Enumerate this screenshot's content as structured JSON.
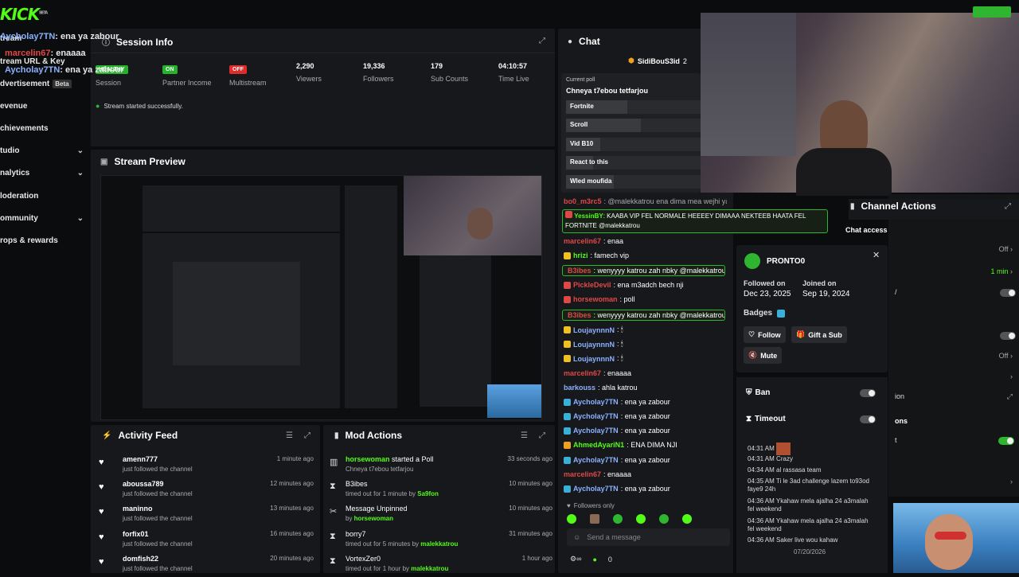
{
  "brand": {
    "logo": "KICK",
    "beta": "BETA"
  },
  "overlay": [
    {
      "name": "Aycholay7TN",
      "text": ": ena ya zabour",
      "color": "blue"
    },
    {
      "name": "marcelin67",
      "text": ": enaaaa",
      "color": "red"
    },
    {
      "name": "Aycholay7TN",
      "text": ": ena ya zabour",
      "color": "blue"
    }
  ],
  "sidebar": {
    "items": [
      {
        "label": "tream"
      },
      {
        "label": "tream URL & Key"
      },
      {
        "label": "dvertisement",
        "badge": "Beta"
      },
      {
        "label": "evenue"
      },
      {
        "label": "chievements"
      },
      {
        "label": "tudio",
        "chevron": true
      },
      {
        "label": "nalytics",
        "chevron": true
      },
      {
        "label": "loderation"
      },
      {
        "label": "ommunity",
        "chevron": true
      },
      {
        "label": "rops & rewards"
      }
    ]
  },
  "session": {
    "title": "Session Info",
    "stats": [
      {
        "value": "HEALTHY",
        "label": "Session",
        "kind": "badge-on"
      },
      {
        "value": "ON",
        "label": "Partner Income",
        "kind": "badge-on"
      },
      {
        "value": "OFF",
        "label": "Multistream",
        "kind": "badge-off"
      },
      {
        "value": "2,290",
        "label": "Viewers"
      },
      {
        "value": "19,336",
        "label": "Followers"
      },
      {
        "value": "179",
        "label": "Sub Counts"
      },
      {
        "value": "04:10:57",
        "label": "Time Live"
      }
    ],
    "status": "Stream started successfully."
  },
  "preview": {
    "title": "Stream Preview"
  },
  "activity": {
    "title": "Activity Feed",
    "rows": [
      {
        "name": "amenn777",
        "sub": "just followed the channel",
        "time": "1 minute ago"
      },
      {
        "name": "aboussa789",
        "sub": "just followed the channel",
        "time": "12 minutes ago"
      },
      {
        "name": "maninno",
        "sub": "just followed the channel",
        "time": "13 minutes ago"
      },
      {
        "name": "forfix01",
        "sub": "just followed the channel",
        "time": "16 minutes ago"
      },
      {
        "name": "domfish22",
        "sub": "just followed the channel",
        "time": "20 minutes ago"
      }
    ]
  },
  "mod": {
    "title": "Mod Actions",
    "rows": [
      {
        "icon": "poll-icon",
        "actor": "horsewoman",
        "action": " started a Poll",
        "sub": "Chneya t7ebou tetfarjou",
        "by": "",
        "time": "33 seconds ago"
      },
      {
        "icon": "hourglass-icon",
        "actor": "",
        "action": "B3ibes",
        "sub": "timed out for 1 minute by ",
        "by": "Sa9fon",
        "time": "10 minutes ago"
      },
      {
        "icon": "unpin-icon",
        "actor": "",
        "action": "Message Unpinned",
        "sub": "by ",
        "by": "horsewoman",
        "time": "10 minutes ago"
      },
      {
        "icon": "hourglass-icon",
        "actor": "",
        "action": "borry7",
        "sub": "timed out for 5 minutes by ",
        "by": "malekkatrou",
        "time": "31 minutes ago"
      },
      {
        "icon": "hourglass-icon",
        "actor": "",
        "action": "VortexZer0",
        "sub": "timed out for 1 hour by ",
        "by": "malekkatrou",
        "time": "1 hour ago"
      }
    ]
  },
  "chat": {
    "title": "Chat",
    "pinned_user": "SidiBouS3id",
    "pinned_count": "2",
    "poll": {
      "label": "Current poll",
      "question": "Chneya t7ebou tetfarjou",
      "options": [
        {
          "label": "Fortnite",
          "fill": 0.45
        },
        {
          "label": "Scroll",
          "fill": 0.55
        },
        {
          "label": "Vid B10",
          "fill": 0.25
        },
        {
          "label": "React to this",
          "fill": 0.2
        },
        {
          "label": "Wled moufida",
          "fill": 0.35
        }
      ]
    },
    "messages": [
      {
        "user": "bo0_m3rc5",
        "text": ": @malekkatrou ena dima mea wejhi ya pro",
        "color": "#e04848",
        "hl": false
      },
      {
        "user": "YessinBY",
        "text": ": KAABA VIP FEL NORMALE HEEEEY DIMAAA NEKTEEB HAATA FEL",
        "color": "#e04848",
        "hl": true
      },
      {
        "user": "",
        "text": "FORTNITE @malekkatrou",
        "color": "#fff",
        "hl": true
      },
      {
        "user": "marcelin67",
        "text": ": enaa",
        "color": "#e04848",
        "hl": false
      },
      {
        "user": "hrizi",
        "text": ": famech vip",
        "color": "#53fc18",
        "hl": false
      },
      {
        "user": "B3ibes",
        "text": ": wenyyyy katrou zah nbky @malekkatrou",
        "color": "#e04848",
        "hl": true
      },
      {
        "user": "PickleDevil",
        "text": ": ena m3adch bech nji",
        "color": "#e04848",
        "hl": false
      },
      {
        "user": "horsewoman",
        "text": ": poll",
        "color": "#e04848",
        "hl": false
      },
      {
        "user": "B3ibes",
        "text": ": wenyyyy katrou zah nbky @malekkatrou",
        "color": "#e04848",
        "hl": true
      },
      {
        "user": "LoujaynnnN",
        "text": ": 🕯",
        "color": "#8cb1ff",
        "hl": false
      },
      {
        "user": "LoujaynnnN",
        "text": ": 🕯",
        "color": "#8cb1ff",
        "hl": false
      },
      {
        "user": "LoujaynnnN",
        "text": ": 🕯",
        "color": "#8cb1ff",
        "hl": false
      },
      {
        "user": "marcelin67",
        "text": ": enaaaa",
        "color": "#e04848",
        "hl": false
      },
      {
        "user": "barkouss",
        "text": ": ahla katrou",
        "color": "#8cb1ff",
        "hl": false
      },
      {
        "user": "Aycholay7TN",
        "text": ": ena ya zabour",
        "color": "#8cb1ff",
        "hl": false
      },
      {
        "user": "Aycholay7TN",
        "text": ": ena ya zabour",
        "color": "#8cb1ff",
        "hl": false
      },
      {
        "user": "Aycholay7TN",
        "text": ": ena ya zabour",
        "color": "#8cb1ff",
        "hl": false
      },
      {
        "user": "AhmedAyariN1",
        "text": ": ENA DIMA NJI",
        "color": "#53fc18",
        "hl": false
      },
      {
        "user": "Aycholay7TN",
        "text": ": ena ya zabour",
        "color": "#8cb1ff",
        "hl": false
      },
      {
        "user": "marcelin67",
        "text": ": enaaaa",
        "color": "#e04848",
        "hl": false
      },
      {
        "user": "Aycholay7TN",
        "text": ": ena ya zabour",
        "color": "#8cb1ff",
        "hl": false
      }
    ],
    "followers_only": "Followers only",
    "send_placeholder": "Send a message",
    "kicks": "0"
  },
  "user_card": {
    "name": "PRONTO0",
    "followed_label": "Followed on",
    "followed": "Dec 23, 2025",
    "joined_label": "Joined on",
    "joined": "Sep 19, 2024",
    "badges_label": "Badges",
    "follow": "Follow",
    "gift": "Gift a Sub",
    "mute": "Mute",
    "ban": "Ban",
    "timeout": "Timeout",
    "log": [
      {
        "t": "04:31 AM",
        "m": ""
      },
      {
        "t": "04:31 AM",
        "m": "Crazy"
      },
      {
        "t": "04:34 AM",
        "m": "al rassasa team"
      },
      {
        "t": "04:35 AM",
        "m": "Ti le 3ad challenge lazem to93od faye9 24h"
      },
      {
        "t": "04:36 AM",
        "m": "Ykahaw mela ajalha 24 a3malah fel weekend"
      },
      {
        "t": "04:36 AM",
        "m": "Ykahaw mela ajalha 24 a3malah fel weekend"
      },
      {
        "t": "04:36 AM",
        "m": "Saker live wou kahaw"
      }
    ],
    "date": "07/20/2026"
  },
  "channel": {
    "title": "Channel Actions",
    "chat_access": "Chat access",
    "rows": [
      {
        "label": "",
        "value": "Off"
      },
      {
        "label": "",
        "value": "1 min"
      },
      {
        "label": "/",
        "value": ""
      },
      {
        "label": "",
        "value": ""
      },
      {
        "label": "",
        "value": "Off"
      },
      {
        "label": "ion",
        "value": ""
      },
      {
        "label": "ons",
        "value": ""
      },
      {
        "label": "t",
        "value": ""
      }
    ]
  },
  "colors": {
    "accent": "#53fc18",
    "panel": "#17181b",
    "bg": "#0b0c0e"
  }
}
